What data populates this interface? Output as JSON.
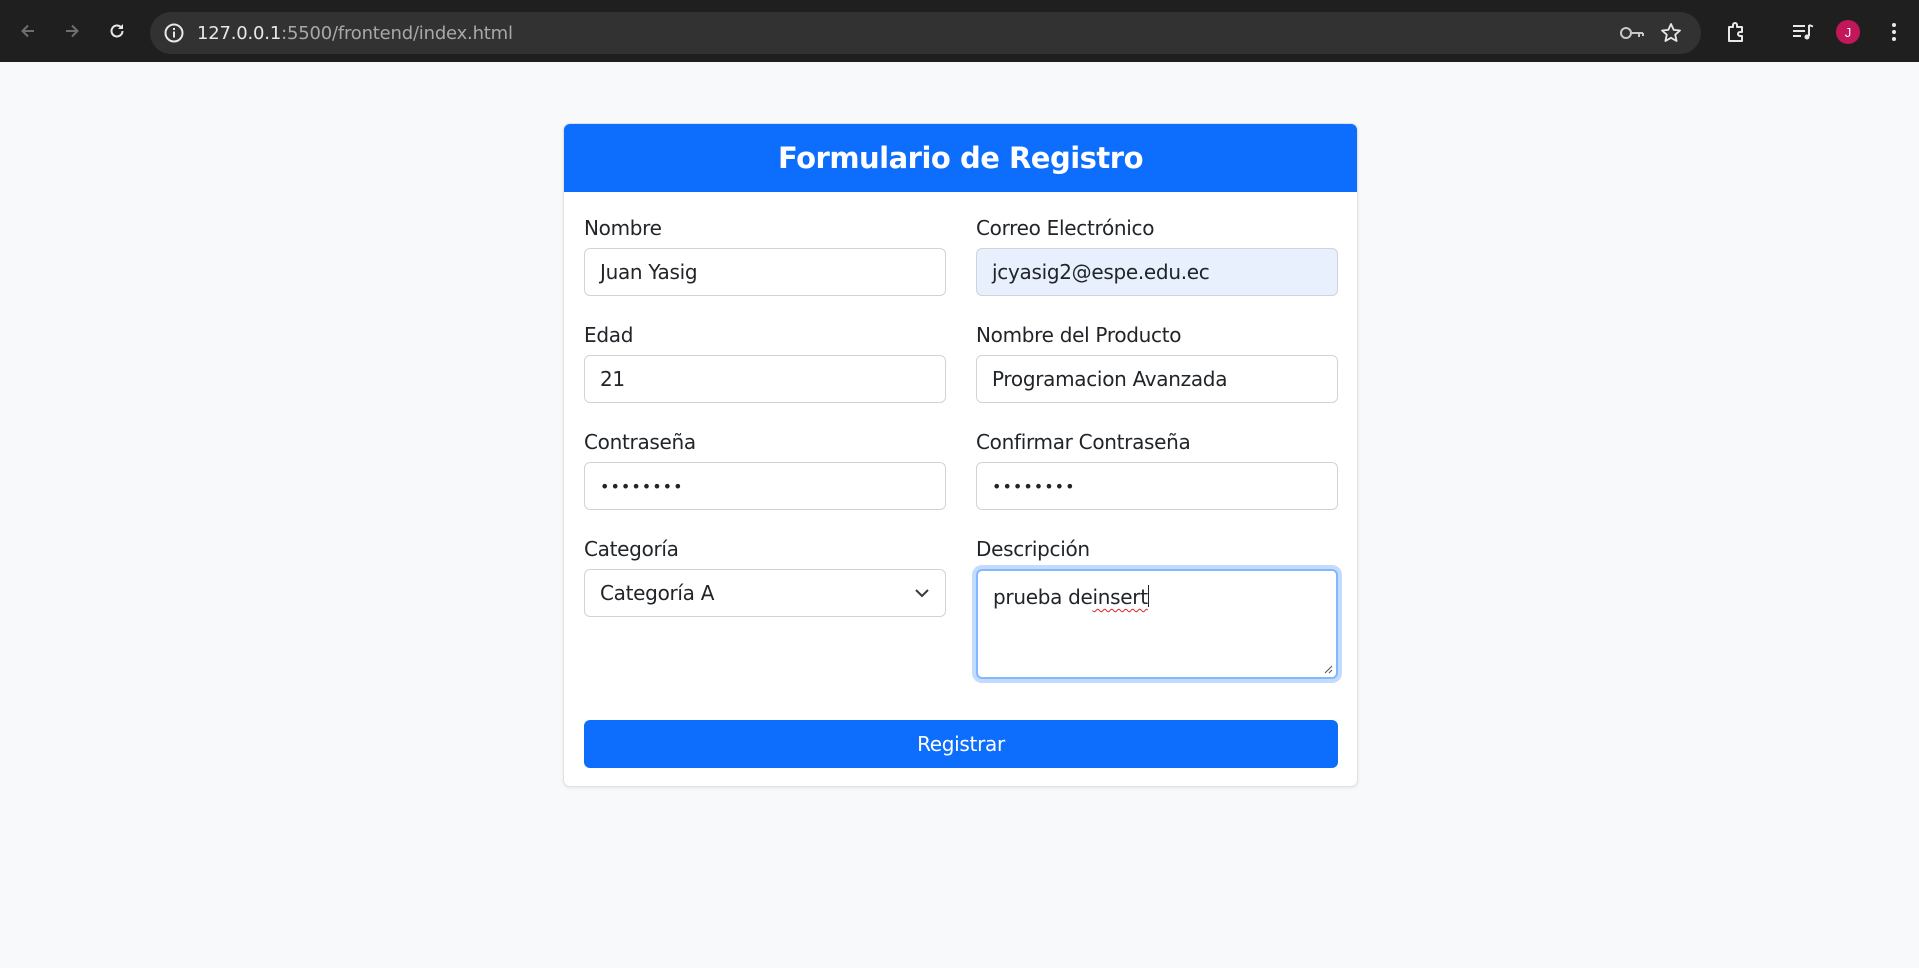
{
  "browser": {
    "url_host": "127.0.0.1",
    "url_rest": ":5500/frontend/index.html",
    "profile_initial": "J",
    "icons": [
      "back-icon",
      "forward-icon",
      "reload-icon",
      "site-info-icon",
      "password-key-icon",
      "bookmark-star-icon",
      "extensions-icon",
      "media-queue-icon",
      "avatar",
      "more-menu-icon"
    ]
  },
  "form": {
    "title": "Formulario de Registro",
    "nombre": {
      "label": "Nombre",
      "value": "Juan Yasig"
    },
    "correo": {
      "label": "Correo Electrónico",
      "value": "jcyasig2@espe.edu.ec"
    },
    "edad": {
      "label": "Edad",
      "value": "21"
    },
    "producto": {
      "label": "Nombre del Producto",
      "value": "Programacion Avanzada"
    },
    "contrasena": {
      "label": "Contraseña",
      "value": "••••••••"
    },
    "confirmar": {
      "label": "Confirmar Contraseña",
      "value": "••••••••"
    },
    "categoria": {
      "label": "Categoría",
      "value": "Categoría A"
    },
    "descripcion": {
      "label": "Descripción",
      "value_before": "prueba de ",
      "value_misspelled": "insert"
    },
    "submit_label": "Registrar"
  },
  "colors": {
    "primary": "#0d6efd",
    "page_bg": "#f8f9fa",
    "chrome_bg": "#1f1f1f",
    "autofill_bg": "#e8f0fe",
    "avatar": "#c2185b"
  }
}
